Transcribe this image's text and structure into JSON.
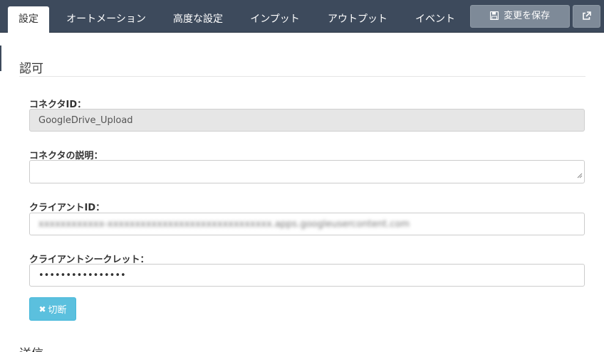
{
  "tabs": [
    {
      "label": "設定",
      "active": true
    },
    {
      "label": "オートメーション",
      "active": false
    },
    {
      "label": "高度な設定",
      "active": false
    },
    {
      "label": "インプット",
      "active": false
    },
    {
      "label": "アウトプット",
      "active": false
    },
    {
      "label": "イベント",
      "active": false
    }
  ],
  "toolbar": {
    "save_label": "変更を保存",
    "save_icon": "floppy-disk-icon",
    "external_icon": "external-link-icon"
  },
  "auth": {
    "title": "認可",
    "connector_id_label": "コネクタID：",
    "connector_id_value": "GoogleDrive_Upload",
    "description_label": "コネクタの説明：",
    "description_value": "",
    "client_id_label": "クライアントID：",
    "client_id_value": "xxxxxxxxxxxx-xxxxxxxxxxxxxxxxxxxxxxxxxxxxxx.apps.googleusercontent.com",
    "client_secret_label": "クライアントシークレット：",
    "client_secret_value": "••••••••••••••••",
    "disconnect_label": "切断",
    "disconnect_icon": "close-icon"
  },
  "next_section": {
    "title": "送信"
  },
  "colors": {
    "tabbar": "#3d4a5c",
    "button_gray": "#7e8a98",
    "info_button": "#5bc0de",
    "readonly_field": "#e6e6e6"
  }
}
